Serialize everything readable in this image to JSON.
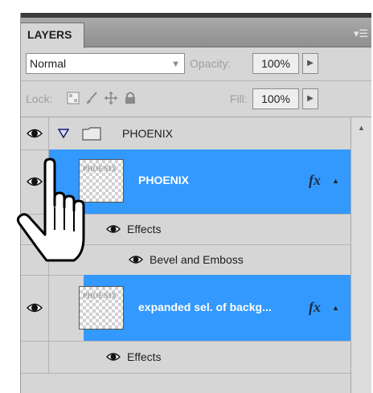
{
  "panel": {
    "tab_label": "LAYERS",
    "menu_icon": "panel-menu-icon"
  },
  "blend": {
    "mode": "Normal",
    "opacity_label": "Opacity:",
    "opacity_value": "100%"
  },
  "lock": {
    "label": "Lock:",
    "fill_label": "Fill:",
    "fill_value": "100%",
    "icons": [
      "lock-transparent-icon",
      "lock-paint-icon",
      "lock-move-icon",
      "lock-all-icon"
    ]
  },
  "layers": [
    {
      "name": "PHOENIX",
      "kind": "group",
      "expanded": true,
      "visible": true
    },
    {
      "name": "PHOENIX",
      "kind": "text-layer",
      "selected": true,
      "visible": true,
      "fx": "fx",
      "thumb_text": "PHOENIX"
    },
    {
      "name": "Effects",
      "kind": "effects-header",
      "visible": true
    },
    {
      "name": "Bevel and Emboss",
      "kind": "effect",
      "visible": true
    },
    {
      "name": "expanded sel. of backg...",
      "kind": "layer",
      "selected": true,
      "visible": true,
      "fx": "fx",
      "thumb_text": "PHOENIX"
    },
    {
      "name": "Effects",
      "kind": "effects-header",
      "visible": true
    }
  ],
  "colors": {
    "selection": "#3399ff",
    "panel_bg": "#d6d6d6",
    "tab_bar": "#9a9a9a"
  },
  "cursor": "hand-pointer-cursor"
}
